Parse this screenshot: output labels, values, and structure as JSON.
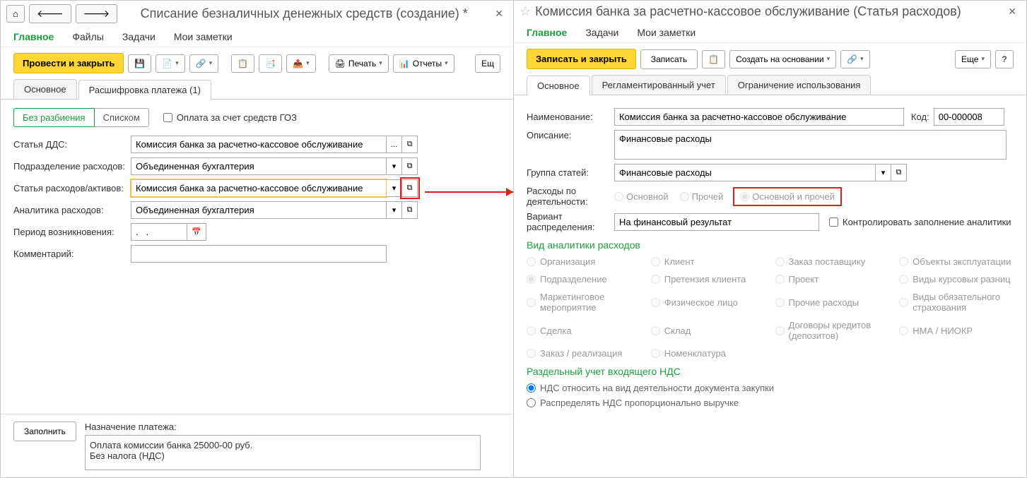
{
  "left": {
    "title": "Списание безналичных денежных средств (создание) *",
    "menu": {
      "main": "Главное",
      "files": "Файлы",
      "tasks": "Задачи",
      "notes": "Мои заметки"
    },
    "toolbar": {
      "postClose": "Провести и закрыть",
      "print": "Печать",
      "reports": "Отчеты",
      "more": "Ещ"
    },
    "tabs": {
      "main": "Основное",
      "detail": "Расшифровка платежа (1)"
    },
    "viewToggle": {
      "noSplit": "Без разбиения",
      "list": "Списком"
    },
    "checkGoz": "Оплата за счет средств ГОЗ",
    "fields": {
      "dds": {
        "label": "Статья ДДС:",
        "value": "Комиссия банка за расчетно-кассовое обслуживание"
      },
      "subdivision": {
        "label": "Подразделение расходов:",
        "value": "Объединенная бухгалтерия"
      },
      "expenseArticle": {
        "label": "Статья расходов/активов:",
        "value": "Комиссия банка за расчетно-кассовое обслуживание"
      },
      "analytics": {
        "label": "Аналитика расходов:",
        "value": "Объединенная бухгалтерия"
      },
      "period": {
        "label": "Период возникновения:",
        "value": ".   ."
      },
      "comment": {
        "label": "Комментарий:",
        "value": ""
      }
    },
    "footer": {
      "fillBtn": "Заполнить",
      "purposeLabel": "Назначение платежа:",
      "purposeText": "Оплата комиссии банка 25000-00 руб.\nБез налога (НДС)"
    }
  },
  "right": {
    "title": "Комиссия банка за расчетно-кассовое обслуживание (Статья расходов)",
    "menu": {
      "main": "Главное",
      "tasks": "Задачи",
      "notes": "Мои заметки"
    },
    "toolbar": {
      "saveClose": "Записать и закрыть",
      "save": "Записать",
      "createBased": "Создать на основании",
      "more": "Еще",
      "help": "?"
    },
    "tabs": {
      "main": "Основное",
      "regulated": "Регламентированный учет",
      "restrict": "Ограничение использования"
    },
    "fields": {
      "name": {
        "label": "Наименование:",
        "value": "Комиссия банка за расчетно-кассовое обслуживание"
      },
      "code": {
        "label": "Код:",
        "value": "00-000008"
      },
      "desc": {
        "label": "Описание:",
        "value": "Финансовые расходы"
      },
      "group": {
        "label": "Группа статей:",
        "value": "Финансовые расходы"
      },
      "activity": {
        "label": "Расходы по деятельности:"
      },
      "distrib": {
        "label": "Вариант распределения:",
        "value": "На финансовый результат"
      },
      "controlAnalytics": "Контролировать заполнение аналитики"
    },
    "activityRadios": {
      "main": "Основной",
      "other": "Прочей",
      "both": "Основной и прочей"
    },
    "analyticsSection": "Вид аналитики расходов",
    "analytics": [
      "Организация",
      "Клиент",
      "Заказ поставщику",
      "Объекты эксплуатации",
      "Подразделение",
      "Претензия клиента",
      "Проект",
      "Виды курсовых разниц",
      "Маркетинговое мероприятие",
      "Физическое лицо",
      "Прочие расходы",
      "Виды обязательного страхования",
      "Сделка",
      "Склад",
      "Договоры кредитов (депозитов)",
      "НМА / НИОКР",
      "Заказ / реализация",
      "Номенклатура",
      "",
      ""
    ],
    "vdsSection": "Раздельный учет входящего НДС",
    "vds": {
      "byActivity": "НДС относить на вид деятельности документа закупки",
      "proportional": "Распределять НДС пропорционально выручке"
    }
  }
}
